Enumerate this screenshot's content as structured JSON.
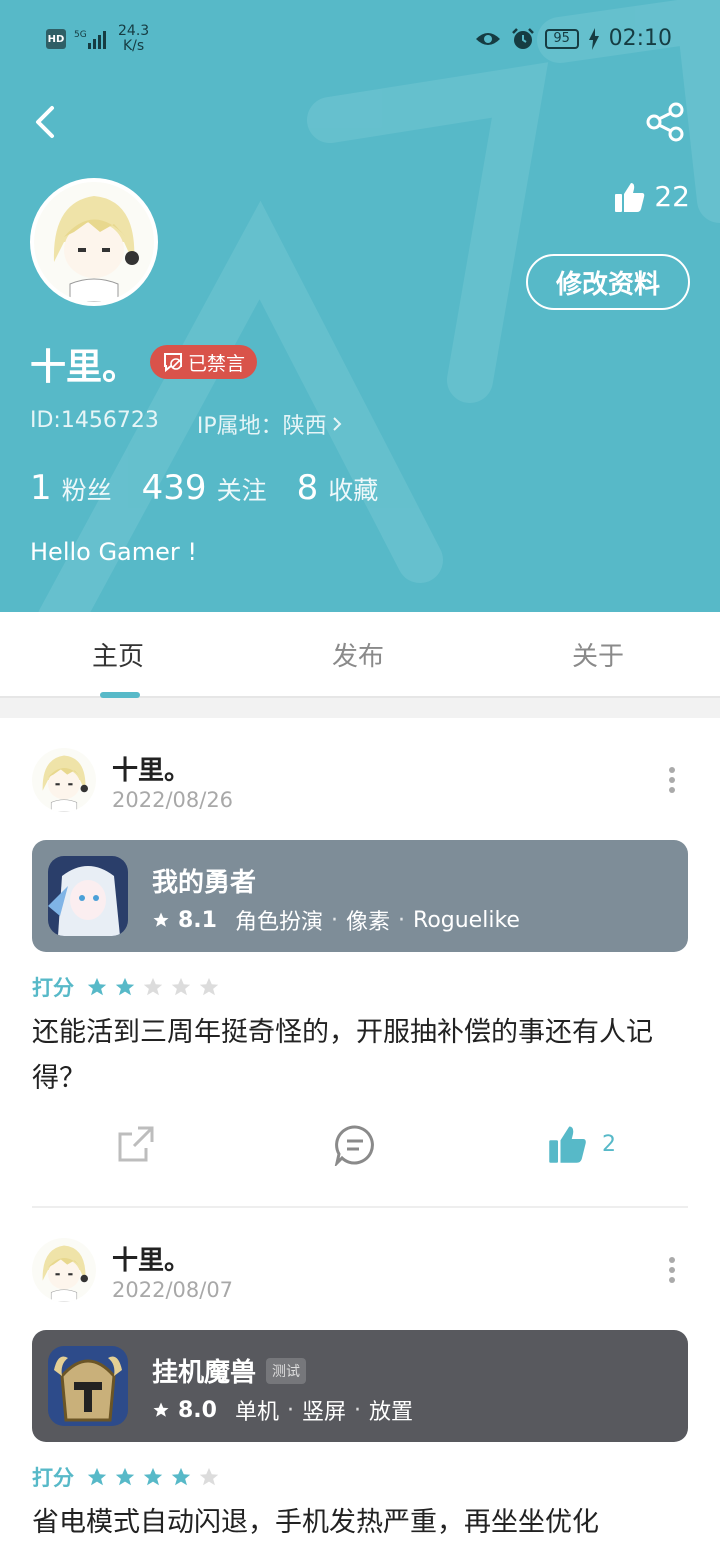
{
  "status_bar": {
    "hd": "HD",
    "net_speed_value": "24.3",
    "net_speed_unit": "K/s",
    "battery": "95",
    "time": "02:10"
  },
  "header": {
    "likes": "22",
    "edit_label": "修改资料",
    "username": "十里。",
    "banned_label": "已禁言",
    "user_id": "ID:1456723",
    "ip_location": "IP属地：陕西",
    "stats": [
      {
        "num": "1",
        "label": "粉丝"
      },
      {
        "num": "439",
        "label": "关注"
      },
      {
        "num": "8",
        "label": "收藏"
      }
    ],
    "bio": "Hello Gamer !"
  },
  "tabs": [
    {
      "label": "主页",
      "active": true
    },
    {
      "label": "发布",
      "active": false
    },
    {
      "label": "关于",
      "active": false
    }
  ],
  "posts": [
    {
      "author": "十里。",
      "date": "2022/08/26",
      "game": {
        "title": "我的勇者",
        "tag": "",
        "score": "8.1",
        "genres": [
          "角色扮演",
          "像素",
          "Roguelike"
        ],
        "card_color": "#7e8d98"
      },
      "rating_label": "打分",
      "rating": 2,
      "text": "还能活到三周年挺奇怪的，开服抽补偿的事还有人记得？",
      "likes": "2"
    },
    {
      "author": "十里。",
      "date": "2022/08/07",
      "game": {
        "title": "挂机魔兽",
        "tag": "测试",
        "score": "8.0",
        "genres": [
          "单机",
          "竖屏",
          "放置"
        ],
        "card_color": "#58595e"
      },
      "rating_label": "打分",
      "rating": 4,
      "text": "省电模式自动闪退，手机发热严重，再坐坐优化",
      "likes": ""
    }
  ],
  "colors": {
    "accent": "#57b9c8",
    "banned": "#d9534a",
    "star_off": "#dcdcdc"
  }
}
